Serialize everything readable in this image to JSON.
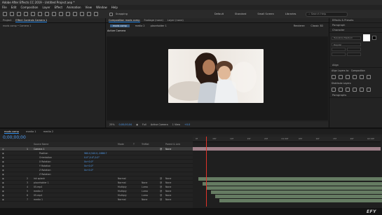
{
  "window": {
    "title": "Adobe After Effects CC 2019 - Untitled Project.aep *"
  },
  "menu": [
    "File",
    "Edit",
    "Composition",
    "Layer",
    "Effect",
    "Animation",
    "View",
    "Window",
    "Help"
  ],
  "toolbar": {
    "snapping": "Snapping",
    "workspaces": [
      "Default",
      "Standard",
      "Small Screen",
      "Libraries"
    ],
    "search_placeholder": "Search Help"
  },
  "left_panel": {
    "tabs": [
      "Project",
      "Effect Controls Camera 1"
    ],
    "subtitle": "mods comp • Camera 1"
  },
  "comp_panel": {
    "tabs": [
      "Composition mods comp",
      "Footage (none)",
      "Layer (none)"
    ],
    "subtabs": [
      "mods comp",
      "media 2",
      "placeholder 1"
    ],
    "renderer_label": "Renderer:",
    "renderer": "Classic 3D",
    "active_camera": "Active Camera",
    "footer": {
      "zoom": "25%",
      "time": "0;00;00;04",
      "resolution": "Full",
      "camera": "Active Camera",
      "views": "1 View",
      "exposure": "+0.0"
    }
  },
  "right_panel": {
    "sections": [
      "Effects & Presets",
      "Paragraph",
      "Character",
      "Align",
      "Paragraphs"
    ],
    "font_family": "Helvetica Medium",
    "font_style": "Regular",
    "align_to_label": "Align Layers to:",
    "align_to": "Composition",
    "distribute_label": "Distribute Layers:"
  },
  "timeline": {
    "tabs": [
      "mods comp",
      "media 1",
      "media 2"
    ],
    "timecode": "0;00;00;00",
    "column_headers": [
      "Source Name",
      "Mode",
      "T",
      "TrkMat",
      "Parent & Link"
    ],
    "parent_value": "None",
    "ruler": [
      "0f",
      "05f",
      "10f",
      "15f",
      "20f",
      "01:00f",
      "05f",
      "10f",
      "15f",
      "20f",
      "02:00f"
    ],
    "layers": [
      {
        "num": "1",
        "name": "Camera 1",
        "mode": "",
        "trk": "",
        "selected": true
      },
      {
        "num": "",
        "name": "Position",
        "mode": "960.0,540.0,-2666.7",
        "trk": "",
        "selected": false
      },
      {
        "num": "",
        "name": "Orientation",
        "mode": "0.0°,0.0°,0.0°",
        "trk": "",
        "selected": false
      },
      {
        "num": "",
        "name": "X Rotation",
        "mode": "0x+0.0°",
        "trk": "",
        "selected": false
      },
      {
        "num": "",
        "name": "Y Rotation",
        "mode": "0x+0.0°",
        "trk": "",
        "selected": false
      },
      {
        "num": "",
        "name": "Z Rotation",
        "mode": "0x+0.0°",
        "trk": "",
        "selected": false
      },
      {
        "num": "",
        "name": "Z Rotation",
        "mode": "",
        "trk": "",
        "selected": false
      },
      {
        "num": "2",
        "name": "ink splash",
        "mode": "Normal",
        "trk": "",
        "selected": false
      },
      {
        "num": "3",
        "name": "placeholder 1",
        "mode": "Normal",
        "trk": "None",
        "selected": false
      },
      {
        "num": "4",
        "name": "05.mp4",
        "mode": "Multiply",
        "trk": "Luma",
        "selected": false
      },
      {
        "num": "5",
        "name": "media 2",
        "mode": "Multiply",
        "trk": "Luma",
        "selected": false
      },
      {
        "num": "6",
        "name": "05.mp4",
        "mode": "Multiply",
        "trk": "Luma",
        "selected": false
      },
      {
        "num": "7",
        "name": "media 1",
        "mode": "Normal",
        "trk": "None",
        "selected": false
      }
    ]
  },
  "watermark": "EFY",
  "colors": {
    "accent": "#2d8ceb",
    "playhead": "#e0342a",
    "label_pink": "#c9a1ad",
    "label_green": "#7e9b7a"
  }
}
